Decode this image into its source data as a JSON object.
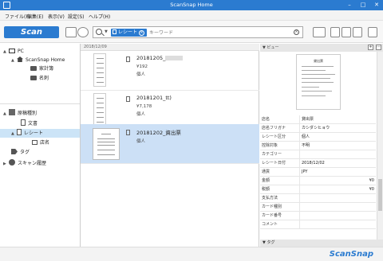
{
  "app": {
    "title": "ScanSnap Home"
  },
  "menu": [
    "ファイル(F)",
    "編集(E)",
    "表示(V)",
    "設定(S)",
    "ヘルプ(H)"
  ],
  "toolbar": {
    "scan_label": "Scan",
    "search_tag": "レシート",
    "search_placeholder": "キーワード"
  },
  "tree": {
    "pc": "PC",
    "scansnap_home": "ScanSnap Home",
    "folder1": "家計簿",
    "folder2": "名刺",
    "doc_types": "原稿種別",
    "doc": "文書",
    "receipt": "レシート",
    "store": "店名",
    "tag": "タグ",
    "history": "スキャン履歴"
  },
  "list": {
    "date_header": "2018/12/09",
    "items": [
      {
        "title": "20181205_",
        "amount": "¥192",
        "type": "個人"
      },
      {
        "title": "20181201_tt)",
        "amount": "¥7,178",
        "type": "個人"
      },
      {
        "title": "20181202_資出票",
        "amount": "",
        "type": "個人"
      }
    ]
  },
  "view": {
    "header": "ビュー",
    "preview_title": "貸出票",
    "tag_header": "タグ",
    "props": [
      {
        "key": "店名",
        "value": "貸出票",
        "right": ""
      },
      {
        "key": "店名フリガナ",
        "value": "カシダシヒョウ",
        "right": ""
      },
      {
        "key": "レシート区分",
        "value": "個人",
        "right": ""
      },
      {
        "key": "控除対象",
        "value": "不明",
        "right": ""
      },
      {
        "key": "カテゴリー",
        "value": "",
        "right": ""
      },
      {
        "key": "レシート日付",
        "value": "2018/12/02",
        "right": ""
      },
      {
        "key": "通貨",
        "value": "JPY",
        "right": ""
      },
      {
        "key": "金額",
        "value": "",
        "right": "¥0"
      },
      {
        "key": "税額",
        "value": "",
        "right": "¥0"
      },
      {
        "key": "支払方法",
        "value": "",
        "right": ""
      },
      {
        "key": "カード種別",
        "value": "",
        "right": ""
      },
      {
        "key": "カード番号",
        "value": "",
        "right": ""
      },
      {
        "key": "コメント",
        "value": "",
        "right": ""
      }
    ]
  },
  "footer": {
    "logo": "ScanSnap"
  },
  "colors": {
    "accent": "#2b7bd0",
    "selection": "#cce0f6"
  }
}
